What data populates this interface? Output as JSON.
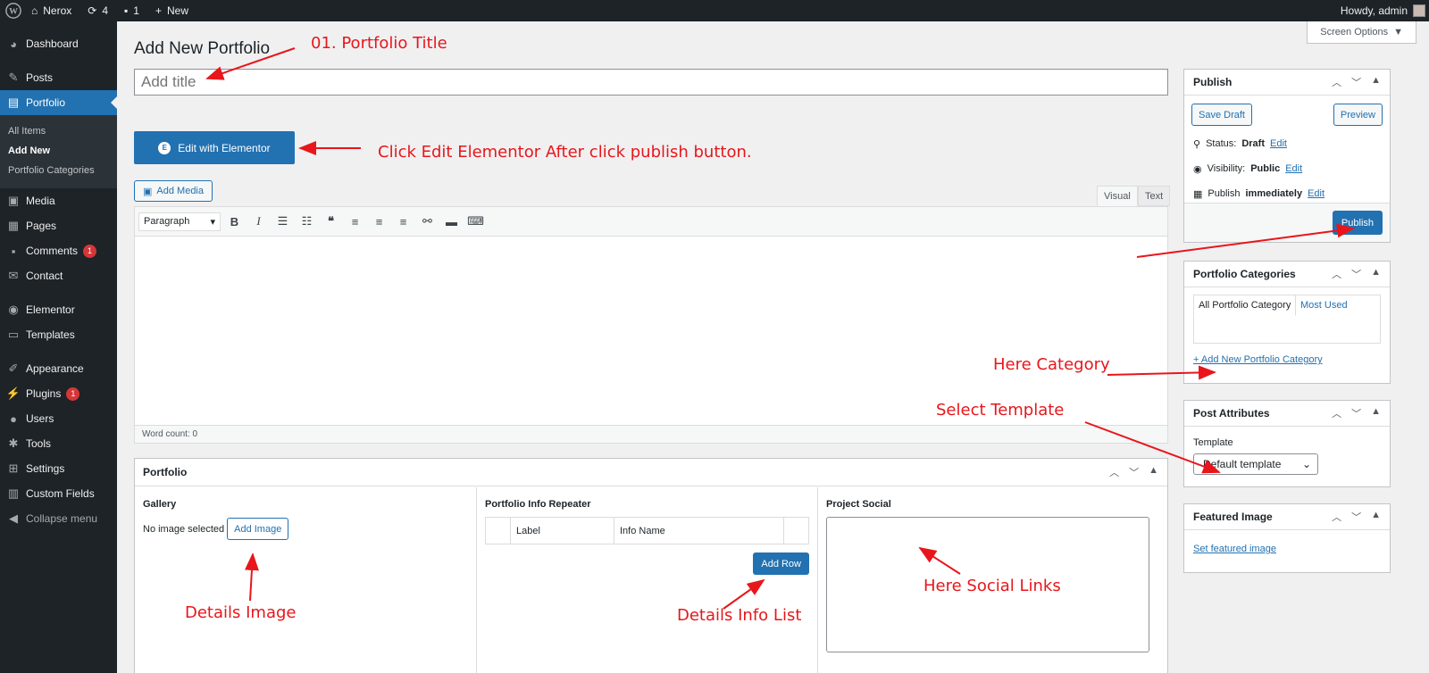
{
  "adminbar": {
    "site_name": "Nerox",
    "updates_count": "4",
    "comments_count": "1",
    "new_label": "New",
    "howdy": "Howdy, admin"
  },
  "sidebar": {
    "dashboard": "Dashboard",
    "posts": "Posts",
    "portfolio": "Portfolio",
    "sub_all_items": "All Items",
    "sub_add_new": "Add New",
    "sub_categories": "Portfolio Categories",
    "media": "Media",
    "pages": "Pages",
    "comments": "Comments",
    "comments_badge": "1",
    "contact": "Contact",
    "elementor": "Elementor",
    "templates": "Templates",
    "appearance": "Appearance",
    "plugins": "Plugins",
    "plugins_badge": "1",
    "users": "Users",
    "tools": "Tools",
    "settings": "Settings",
    "custom_fields": "Custom Fields",
    "collapse": "Collapse menu"
  },
  "main": {
    "page_title": "Add New Portfolio",
    "screen_options": "Screen Options",
    "title_placeholder": "Add title",
    "elementor_button": "Edit with Elementor",
    "add_media": "Add Media",
    "tab_visual": "Visual",
    "tab_text": "Text",
    "format_select": "Paragraph",
    "word_count": "Word count: 0"
  },
  "portfolio_box": {
    "title": "Portfolio",
    "gallery_title": "Gallery",
    "no_image": "No image selected",
    "add_image": "Add Image",
    "repeater_title": "Portfolio Info Repeater",
    "col_label": "Label",
    "col_info_name": "Info Name",
    "add_row": "Add Row",
    "social_title": "Project Social"
  },
  "publish_box": {
    "title": "Publish",
    "save_draft": "Save Draft",
    "preview": "Preview",
    "status_label": "Status:",
    "status_value": "Draft",
    "visibility_label": "Visibility:",
    "visibility_value": "Public",
    "publish_label": "Publish",
    "publish_value": "immediately",
    "edit": "Edit",
    "publish_button": "Publish"
  },
  "categories_box": {
    "title": "Portfolio Categories",
    "tab_all": "All Portfolio Category",
    "tab_most_used": "Most Used",
    "add_new": "+ Add New Portfolio Category"
  },
  "attributes_box": {
    "title": "Post Attributes",
    "template_label": "Template",
    "template_value": "Default template"
  },
  "featured_box": {
    "title": "Featured Image",
    "set_link": "Set featured image"
  },
  "annotations": {
    "title_note": "01. Portfolio Title",
    "elementor_note": "Click Edit Elementor After click publish button.",
    "category_note": "Here Category",
    "template_note": "Select Template",
    "image_note": "Details Image",
    "info_note": "Details Info List",
    "social_note": "Here Social Links"
  },
  "colors": {
    "accent": "#2271b1",
    "adminbar": "#1d2327",
    "annotation": "#e8161b",
    "badge": "#d63638"
  }
}
